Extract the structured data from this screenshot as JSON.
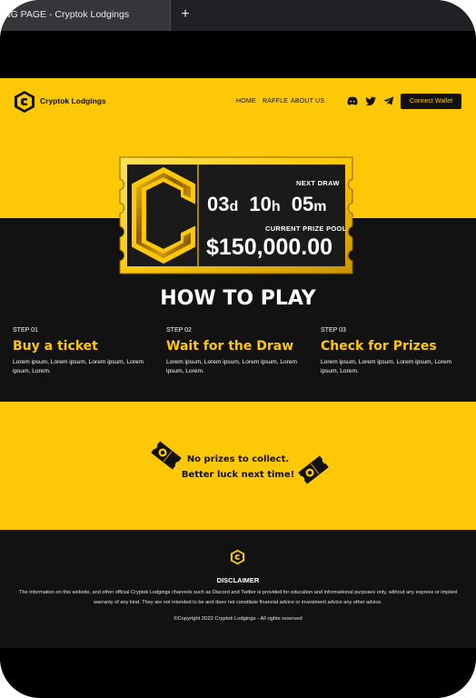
{
  "browser": {
    "tab_title": "NG PAGE - Cryptok Lodgings",
    "new_tab_symbol": "+"
  },
  "header": {
    "brand": "Cryptok Lodgings",
    "nav": [
      "HOME",
      "RAFFLE",
      "ABOUT US"
    ],
    "social_icons": [
      "discord-icon",
      "twitter-icon",
      "telegram-icon"
    ],
    "connect_wallet": "Connect Wallet"
  },
  "raffle": {
    "next_draw_label": "NEXT DRAW",
    "days": "03",
    "days_unit": "d",
    "hours": "10",
    "hours_unit": "h",
    "minutes": "05",
    "minutes_unit": "m",
    "pool_label": "CURRENT PRIZE POOL",
    "pool_value": "$150,000.00"
  },
  "how_to_play": {
    "title": "HOW TO PLAY",
    "steps": [
      {
        "num": "STEP 01",
        "title": "Buy a ticket",
        "desc": "Lorem ipsum, Lorem ipsum, Lorem ipsum, Lorem ipsum, Lorem."
      },
      {
        "num": "STEP 02",
        "title": "Wait for the Draw",
        "desc": "Lorem ipsum, Lorem ipsum, Lorem ipsum, Lorem ipsum, Lorem."
      },
      {
        "num": "STEP 03",
        "title": "Check for Prizes",
        "desc": "Lorem ipsum, Lorem ipsum, Lorem ipsum, Lorem ipsum, Lorem."
      }
    ]
  },
  "prizes": {
    "line1": "No prizes to collect.",
    "line2": "Better luck next time!"
  },
  "footer": {
    "disclaimer_title": "DISCLAIMER",
    "disclaimer_text": "The information on this website, and other official Cryptok Lodgings channels such as Discord and Twitter is provided for education and informational purposes only, without any express or implied warranty of any kind. They are not intended to be and does not constitute financial advice or investment advice any other advice.",
    "copyright": "©Copyright 2022 Cryptok Lodgings - All rights reserved"
  },
  "colors": {
    "brand_yellow": "#fdc807",
    "dark": "#121212"
  }
}
